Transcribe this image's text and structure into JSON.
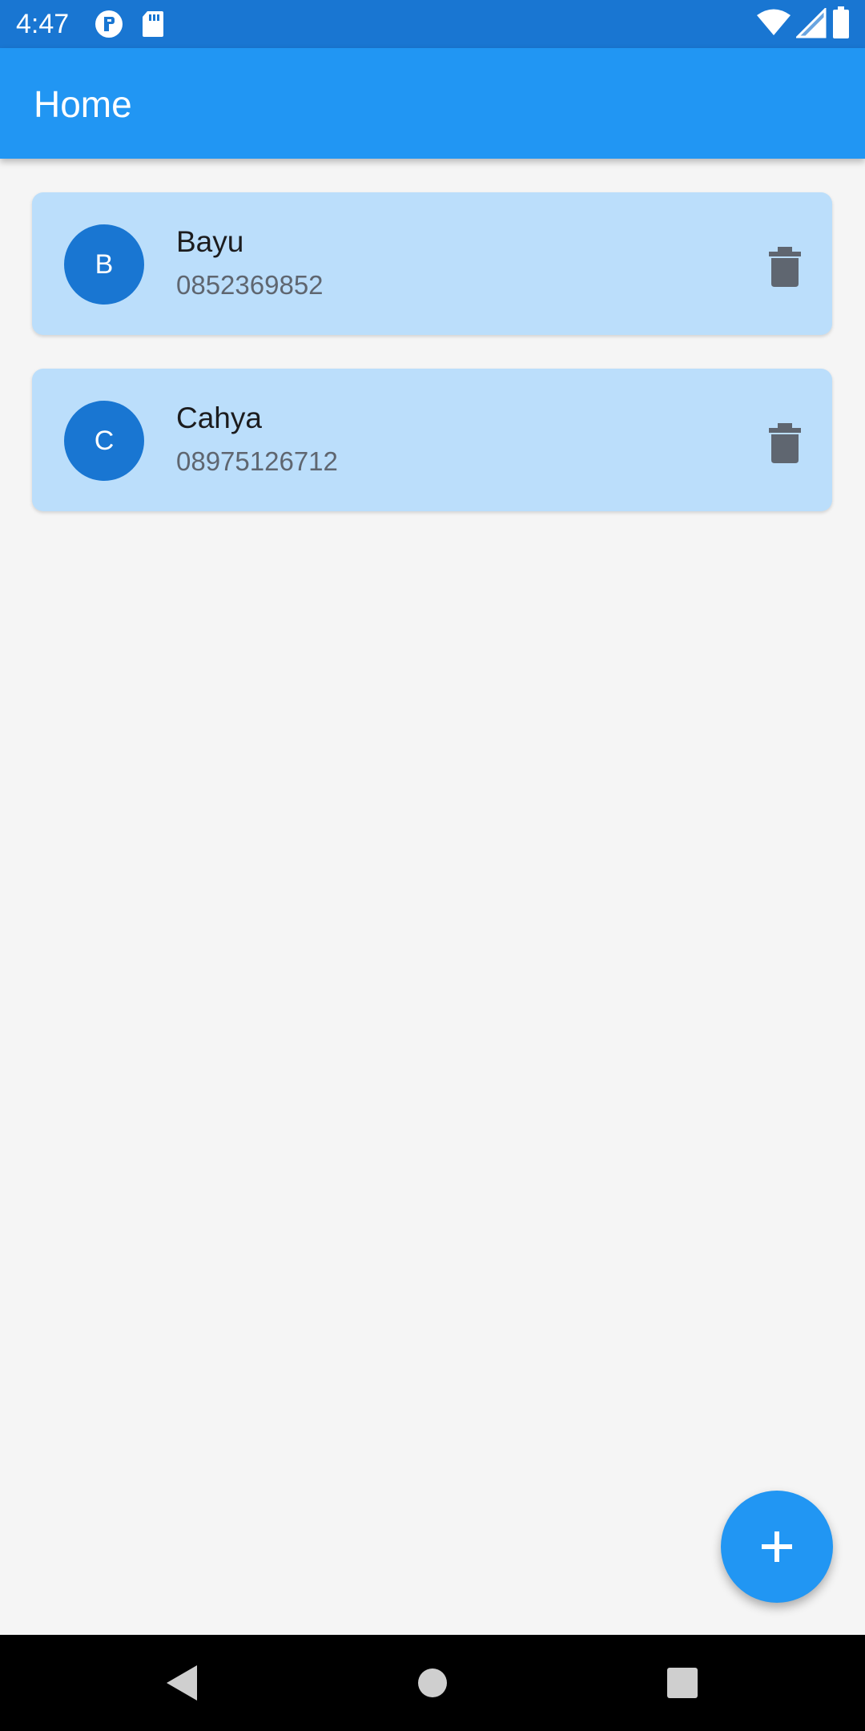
{
  "status_bar": {
    "time": "4:47",
    "icons": [
      "app-notification-icon",
      "sd-card-icon",
      "wifi-icon",
      "cell-signal-icon",
      "battery-icon"
    ]
  },
  "app_bar": {
    "title": "Home"
  },
  "contacts": [
    {
      "initial": "B",
      "name": "Bayu",
      "phone": "0852369852"
    },
    {
      "initial": "C",
      "name": "Cahya",
      "phone": "08975126712"
    }
  ],
  "fab": {
    "icon": "add-icon"
  },
  "nav_bar": {
    "icons": [
      "back-icon",
      "home-icon",
      "recents-icon"
    ]
  },
  "colors": {
    "status_bar": "#1976d2",
    "app_bar": "#2196f3",
    "card_background": "#bbdefb",
    "avatar": "#1976d2",
    "fab": "#2196f3",
    "delete_icon": "#5f6670"
  }
}
